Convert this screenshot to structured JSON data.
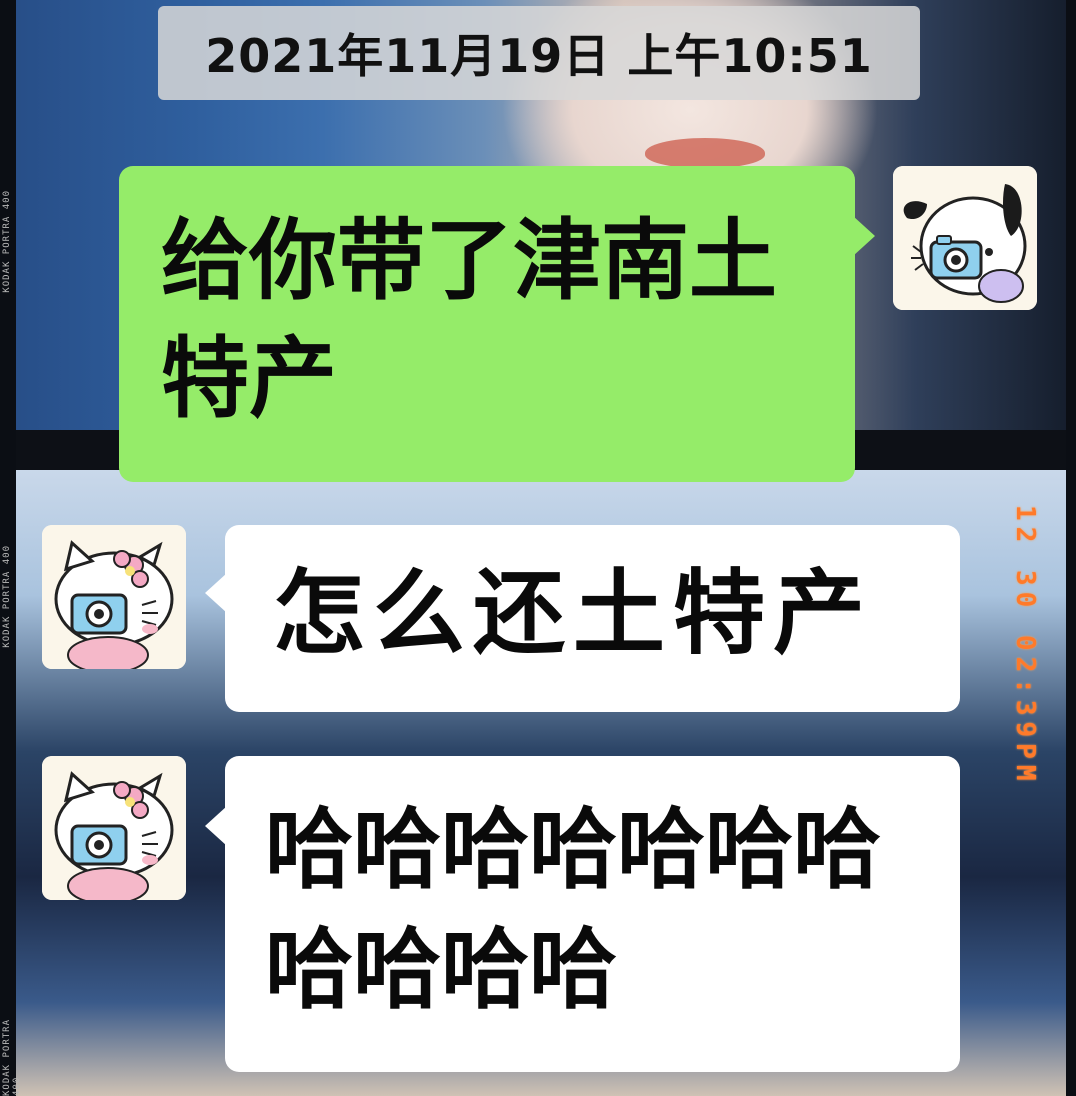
{
  "chat": {
    "timestamp": "2021年11月19日 上午10:51",
    "messages": [
      {
        "side": "right",
        "text": "给你带了津南土特产",
        "avatar_icon": "pochacco-camera-avatar-icon"
      },
      {
        "side": "left",
        "text": "怎么还土特产",
        "avatar_icon": "hello-kitty-camera-avatar-icon"
      },
      {
        "side": "left",
        "text": "哈哈哈哈哈哈哈哈哈哈哈",
        "avatar_icon": "hello-kitty-camera-avatar-icon"
      }
    ]
  },
  "background": {
    "film_label": "KODAK PORTRA 400",
    "date_stamp": "12 30 02:39PM"
  },
  "colors": {
    "outgoing_bubble": "#95ec69",
    "incoming_bubble": "#ffffff",
    "date_stamp": "#ff7a2a"
  }
}
